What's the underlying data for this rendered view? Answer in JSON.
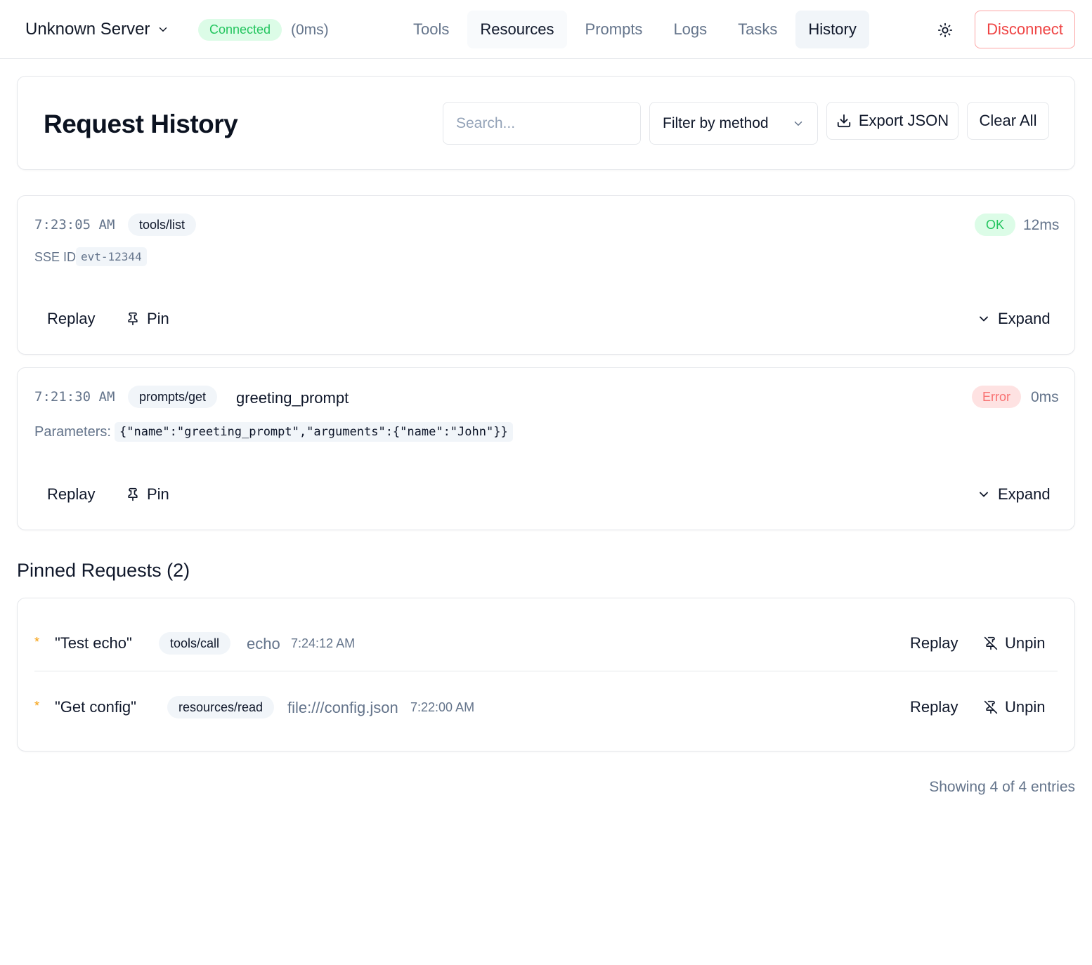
{
  "header": {
    "server_name": "Unknown Server",
    "connection_status": "Connected",
    "latency": "(0ms)",
    "tabs": [
      {
        "label": "Tools"
      },
      {
        "label": "Resources"
      },
      {
        "label": "Prompts"
      },
      {
        "label": "Logs"
      },
      {
        "label": "Tasks"
      },
      {
        "label": "History"
      }
    ],
    "active_tab": "History",
    "disconnect_label": "Disconnect"
  },
  "history": {
    "title": "Request History",
    "search_placeholder": "Search...",
    "filter_label": "Filter by method",
    "export_label": "Export JSON",
    "clear_label": "Clear All"
  },
  "entries": [
    {
      "time": "7:23:05 AM",
      "method": "tools/list",
      "status": "OK",
      "duration": "12ms",
      "meta_label": "SSE ID:",
      "meta_value": "evt-12344",
      "replay_label": "Replay",
      "pin_label": "Pin",
      "expand_label": "Expand"
    },
    {
      "time": "7:21:30 AM",
      "method": "prompts/get",
      "target": "greeting_prompt",
      "status": "Error",
      "duration": "0ms",
      "meta_label": "Parameters:",
      "meta_value": "{\"name\":\"greeting_prompt\",\"arguments\":{\"name\":\"John\"}}",
      "replay_label": "Replay",
      "pin_label": "Pin",
      "expand_label": "Expand"
    }
  ],
  "pinned": {
    "title": "Pinned Requests (2)",
    "items": [
      {
        "star": "*",
        "name": "\"Test echo\"",
        "method": "tools/call",
        "target": "echo",
        "time": "7:24:12 AM",
        "replay_label": "Replay",
        "unpin_label": "Unpin"
      },
      {
        "star": "*",
        "name": "\"Get config\"",
        "method": "resources/read",
        "target": "file:///config.json",
        "time": "7:22:00 AM",
        "replay_label": "Replay",
        "unpin_label": "Unpin"
      }
    ]
  },
  "footer": {
    "summary": "Showing 4 of 4 entries"
  },
  "colors": {
    "success": "#22c55e",
    "error": "#ef4444",
    "star": "#f59e0b",
    "muted": "#64748b"
  }
}
